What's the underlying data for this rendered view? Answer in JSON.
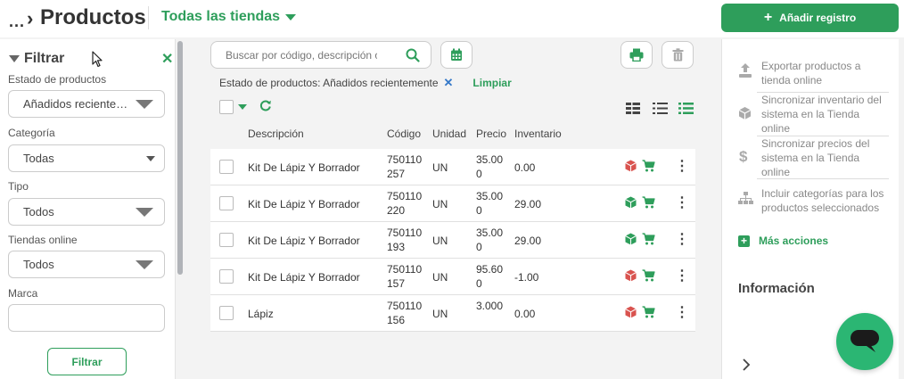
{
  "header": {
    "breadcrumb_dots": "...",
    "title": "Productos",
    "store_selector": "Todas las tiendas",
    "add_button": "Añadir registro"
  },
  "filter": {
    "title": "Filtrar",
    "fields": [
      {
        "label": "Estado de productos",
        "value": "Añadidos recientemente"
      },
      {
        "label": "Categoría",
        "value": "Todas"
      },
      {
        "label": "Tipo",
        "value": "Todos"
      },
      {
        "label": "Tiendas online",
        "value": "Todos"
      },
      {
        "label": "Marca",
        "value": ""
      }
    ],
    "button": "Filtrar"
  },
  "search": {
    "placeholder": "Buscar por código, descripción o"
  },
  "active_filter": {
    "text": "Estado de productos: Añadidos recientemente",
    "clear": "Limpiar"
  },
  "table": {
    "columns": [
      "Descripción",
      "Código",
      "Unidad",
      "Precio",
      "Inventario"
    ],
    "rows": [
      {
        "descripcion": "Kit De Lápiz Y Borrador",
        "codigo1": "750110",
        "codigo2": "257",
        "unidad": "UN",
        "precio1": "35.00",
        "precio2": "0",
        "inventario": "0.00",
        "status_color": "#d9534f"
      },
      {
        "descripcion": "Kit De Lápiz Y Borrador",
        "codigo1": "750110",
        "codigo2": "220",
        "unidad": "UN",
        "precio1": "35.00",
        "precio2": "0",
        "inventario": "29.00",
        "status_color": "#2e9e5b"
      },
      {
        "descripcion": "Kit De Lápiz Y Borrador",
        "codigo1": "750110",
        "codigo2": "193",
        "unidad": "UN",
        "precio1": "35.00",
        "precio2": "0",
        "inventario": "29.00",
        "status_color": "#2e9e5b"
      },
      {
        "descripcion": "Kit De Lápiz Y Borrador",
        "codigo1": "750110",
        "codigo2": "157",
        "unidad": "UN",
        "precio1": "95.60",
        "precio2": "0",
        "inventario": "-1.00",
        "status_color": "#d9534f"
      },
      {
        "descripcion": "Lápiz",
        "codigo1": "750110",
        "codigo2": "156",
        "unidad": "UN",
        "precio1": "3.000",
        "precio2": "",
        "inventario": "0.00",
        "status_color": "#d9534f"
      }
    ]
  },
  "actions": {
    "items": [
      "Exportar productos a tienda online",
      "Sincronizar inventario del sistema en la Tienda online",
      "Sincronizar precios del sistema en la Tienda online",
      "Incluir categorías para los productos seleccionados"
    ],
    "more": "Más acciones"
  },
  "info_title": "Información",
  "colors": {
    "accent": "#2e9e5b",
    "danger": "#d9534f"
  }
}
